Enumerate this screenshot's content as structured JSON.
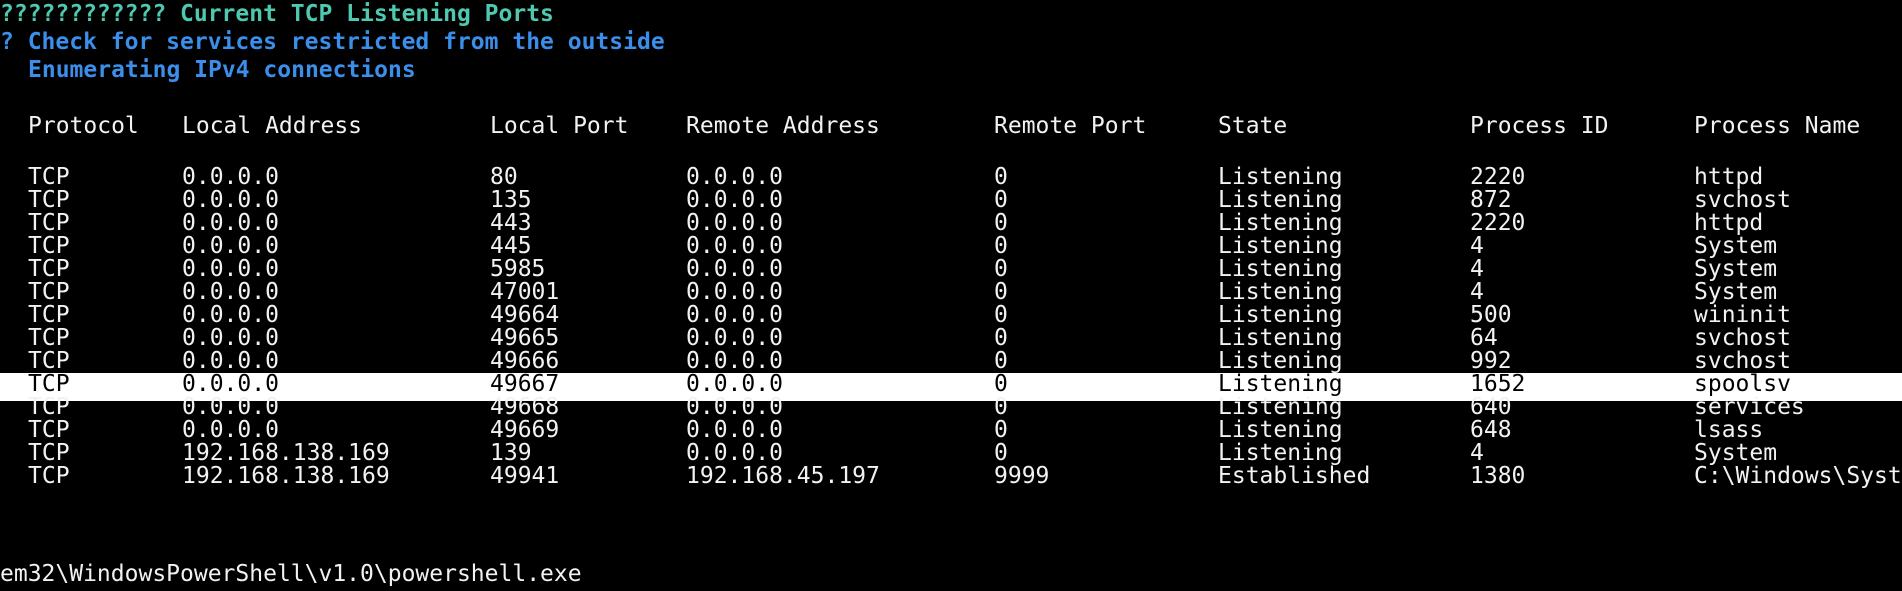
{
  "terminal": {
    "section_title": "???????????? Current TCP Listening Ports",
    "subtitle": "? Check for services restricted from the outside",
    "enum_line": "Enumerating IPv4 connections",
    "wrap_line": "em32\\WindowsPowerShell\\v1.0\\powershell.exe"
  },
  "table": {
    "columns": [
      "Protocol",
      "Local Address",
      "Local Port",
      "Remote Address",
      "Remote Port",
      "State",
      "Process ID",
      "Process Name"
    ],
    "rows": [
      [
        "TCP",
        "0.0.0.0",
        "80",
        "0.0.0.0",
        "0",
        "Listening",
        "2220",
        "httpd"
      ],
      [
        "TCP",
        "0.0.0.0",
        "135",
        "0.0.0.0",
        "0",
        "Listening",
        "872",
        "svchost"
      ],
      [
        "TCP",
        "0.0.0.0",
        "443",
        "0.0.0.0",
        "0",
        "Listening",
        "2220",
        "httpd"
      ],
      [
        "TCP",
        "0.0.0.0",
        "445",
        "0.0.0.0",
        "0",
        "Listening",
        "4",
        "System"
      ],
      [
        "TCP",
        "0.0.0.0",
        "5985",
        "0.0.0.0",
        "0",
        "Listening",
        "4",
        "System"
      ],
      [
        "TCP",
        "0.0.0.0",
        "47001",
        "0.0.0.0",
        "0",
        "Listening",
        "4",
        "System"
      ],
      [
        "TCP",
        "0.0.0.0",
        "49664",
        "0.0.0.0",
        "0",
        "Listening",
        "500",
        "wininit"
      ],
      [
        "TCP",
        "0.0.0.0",
        "49665",
        "0.0.0.0",
        "0",
        "Listening",
        "64",
        "svchost"
      ],
      [
        "TCP",
        "0.0.0.0",
        "49666",
        "0.0.0.0",
        "0",
        "Listening",
        "992",
        "svchost"
      ],
      [
        "TCP",
        "0.0.0.0",
        "49667",
        "0.0.0.0",
        "0",
        "Listening",
        "1652",
        "spoolsv"
      ],
      [
        "TCP",
        "0.0.0.0",
        "49668",
        "0.0.0.0",
        "0",
        "Listening",
        "640",
        "services"
      ],
      [
        "TCP",
        "0.0.0.0",
        "49669",
        "0.0.0.0",
        "0",
        "Listening",
        "648",
        "lsass"
      ],
      [
        "TCP",
        "192.168.138.169",
        "139",
        "0.0.0.0",
        "0",
        "Listening",
        "4",
        "System"
      ],
      [
        "TCP",
        "192.168.138.169",
        "49941",
        "192.168.45.197",
        "9999",
        "Established",
        "1380",
        "C:\\Windows\\Syst"
      ]
    ],
    "highlighted_row": 9
  },
  "colors": {
    "background": "#000000",
    "text": "#f2f2f2",
    "title_cyan": "#4ec9b0",
    "header_blue": "#3b8eea",
    "selection": "#ffffff"
  }
}
